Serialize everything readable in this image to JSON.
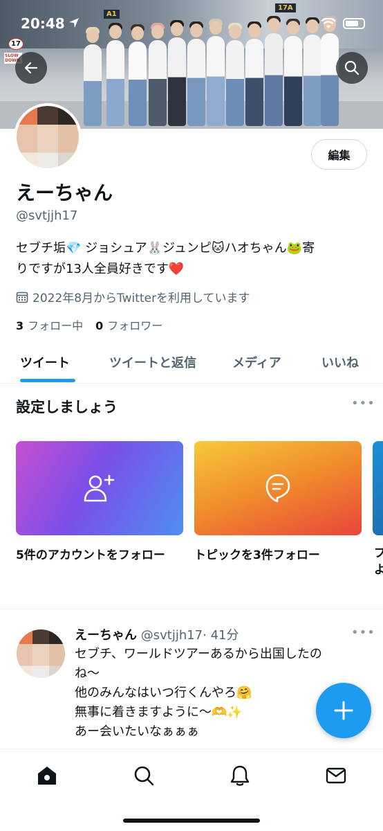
{
  "status_bar": {
    "time": "20:48"
  },
  "banner": {
    "signs": [
      "A1",
      "17A",
      "17",
      "SLOW DOWN"
    ]
  },
  "profile": {
    "edit_label": "編集",
    "display_name": "えーちゃん",
    "handle": "@svtjjh17",
    "bio_line1": "セブチ垢💎 ジョシュア🐰ジュンピ🐱ハオちゃん🐸寄",
    "bio_line2": "りですが13人全員好きです❤️",
    "joined": "2022年8月からTwitterを利用しています",
    "following_count": "3",
    "following_label": "フォロー中",
    "followers_count": "0",
    "followers_label": "フォロワー"
  },
  "tabs": [
    {
      "label": "ツイート",
      "active": true
    },
    {
      "label": "ツイートと返信",
      "active": false
    },
    {
      "label": "メディア",
      "active": false
    },
    {
      "label": "いいね",
      "active": false
    }
  ],
  "setup": {
    "title": "設定しましょう",
    "cards": [
      {
        "label": "5件のアカウントをフォロー",
        "icon": "add-user-icon"
      },
      {
        "label": "トピックを3件フォロー",
        "icon": "topic-bubble-icon"
      },
      {
        "label": "プ…よ",
        "icon": "partial-card-icon"
      }
    ]
  },
  "tweet": {
    "name": "えーちゃん",
    "handle": "@svtjjh17",
    "time": "· 41分",
    "lines": [
      "セブチ、ワールドツアーあるから出国したの",
      "ね〜",
      "他のみんなはいつ行くんやろ🤗",
      "無事に着きますように〜🫶✨",
      "あー会いたいなぁぁぁ"
    ]
  },
  "bottom_nav": [
    "home-icon",
    "search-icon",
    "notifications-icon",
    "messages-icon"
  ],
  "colors": {
    "accent": "#1d9bf0",
    "text": "#0f1419",
    "secondary": "#536471"
  }
}
